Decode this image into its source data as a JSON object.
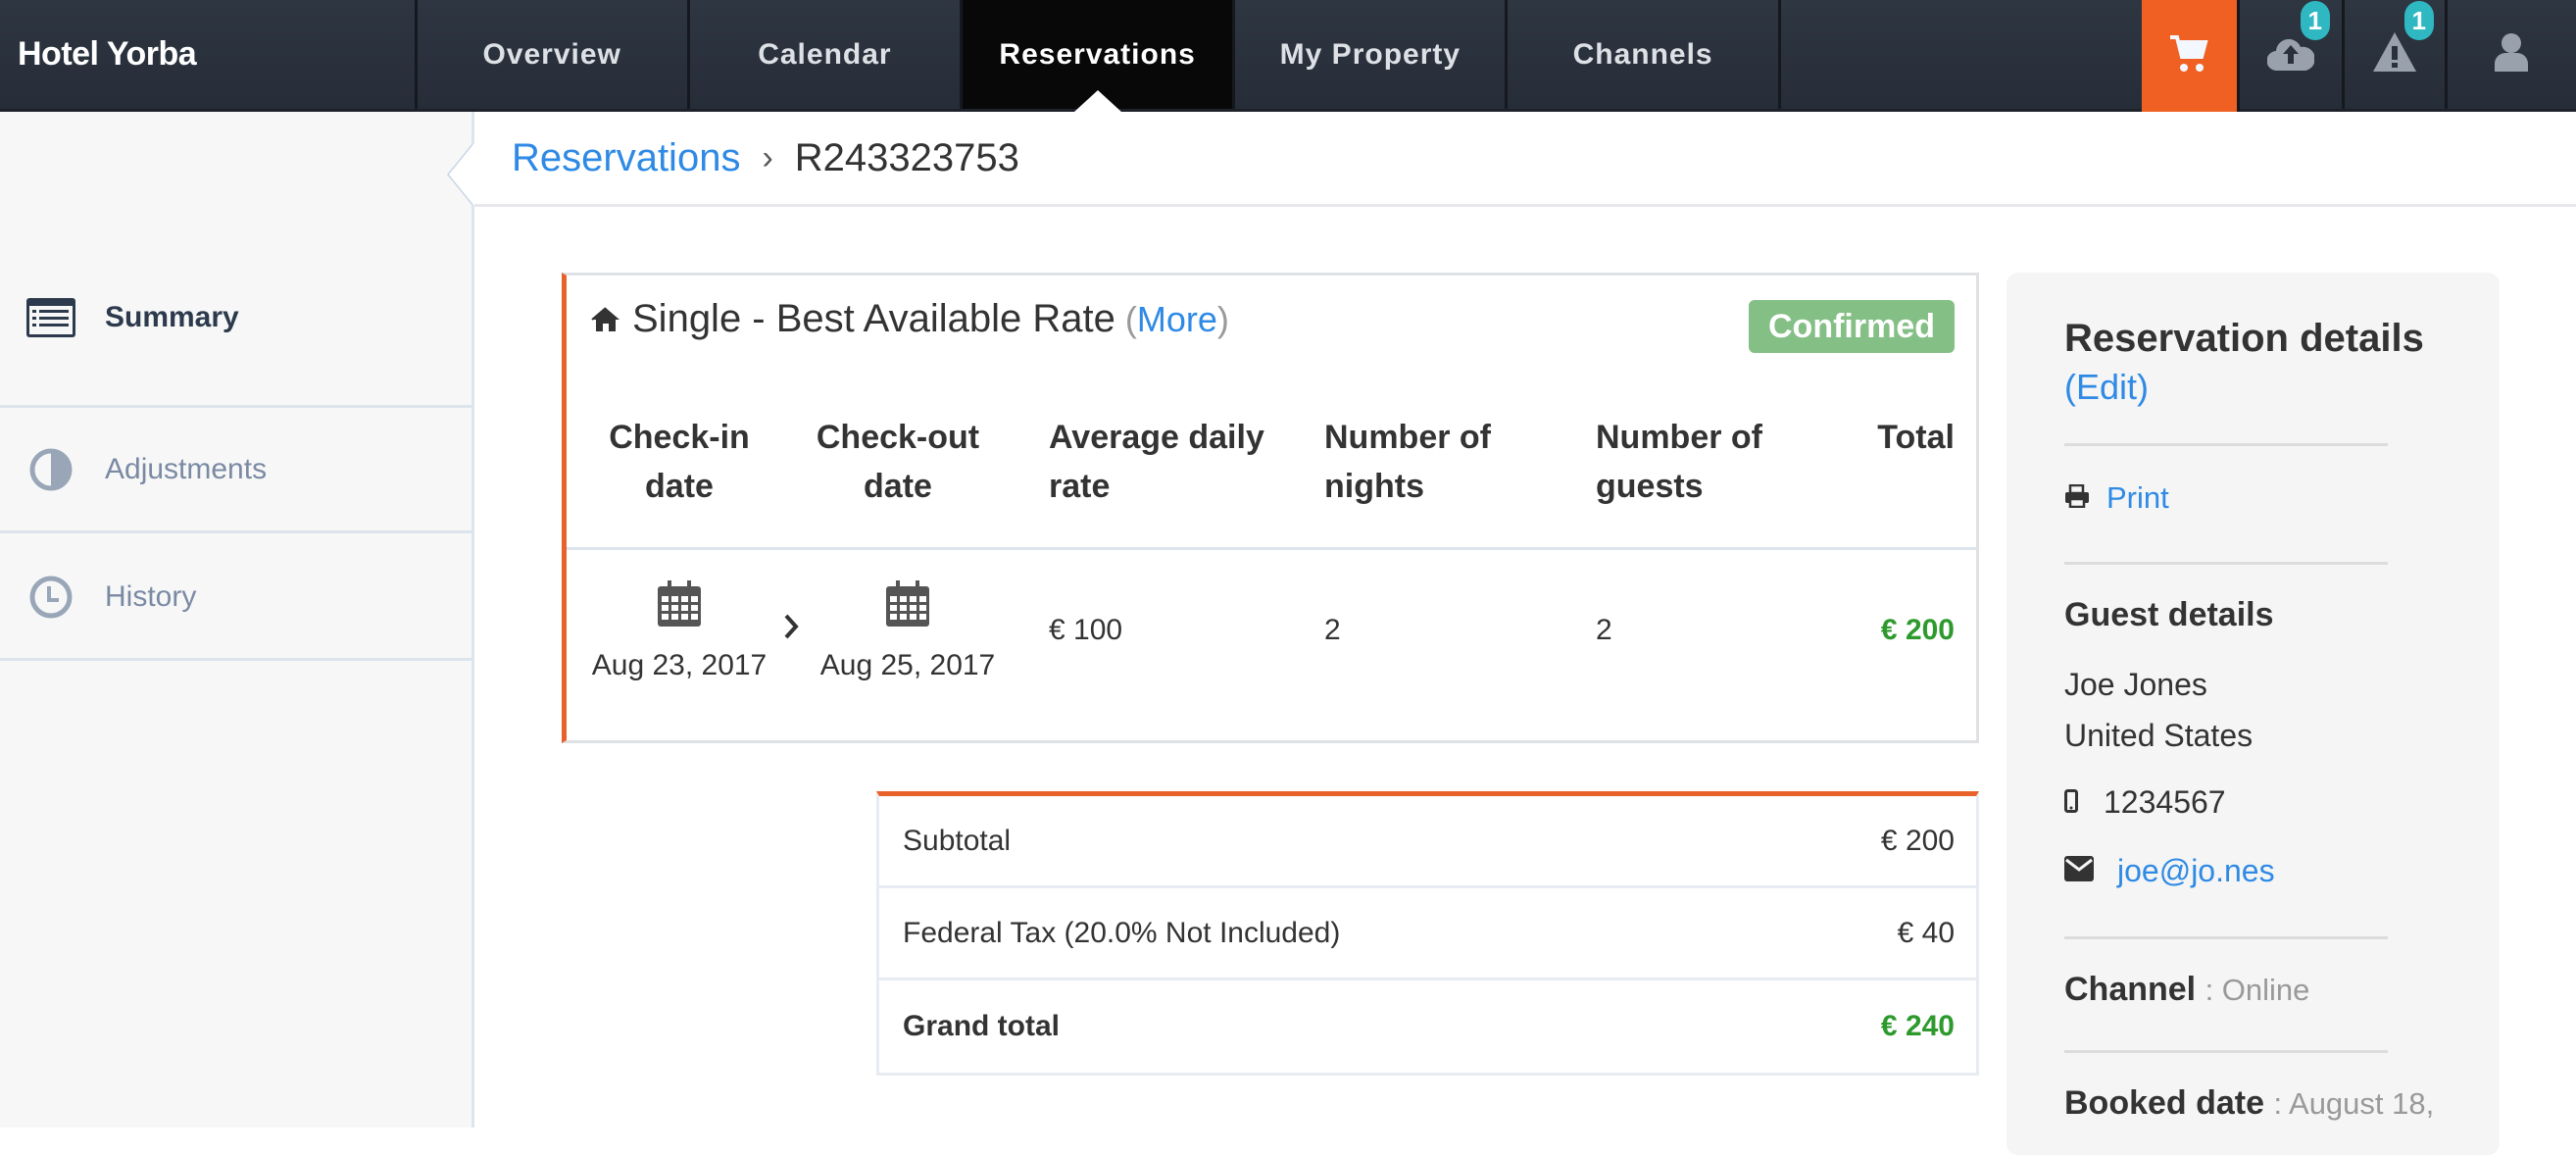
{
  "app": {
    "brand": "Hotel Yorba"
  },
  "nav": {
    "tabs": [
      {
        "label": "Overview",
        "active": false
      },
      {
        "label": "Calendar",
        "active": false
      },
      {
        "label": "Reservations",
        "active": true
      },
      {
        "label": "My Property",
        "active": false
      },
      {
        "label": "Channels",
        "active": false
      }
    ],
    "icons": [
      {
        "name": "cart-icon",
        "badge": null
      },
      {
        "name": "cloud-upload-icon",
        "badge": "1"
      },
      {
        "name": "warning-icon",
        "badge": "1"
      },
      {
        "name": "user-icon",
        "badge": null
      }
    ],
    "accent_color": "#f06022"
  },
  "sidebar": {
    "items": [
      {
        "label": "Summary",
        "icon": "list-icon",
        "active": true
      },
      {
        "label": "Adjustments",
        "icon": "contrast-icon",
        "active": false
      },
      {
        "label": "History",
        "icon": "clock-icon",
        "active": false
      }
    ]
  },
  "breadcrumb": {
    "parent": "Reservations",
    "separator": "›",
    "current": "R243323753"
  },
  "room": {
    "title": "Single - Best Available Rate",
    "more_open": "(",
    "more_label": "More",
    "more_close": ")",
    "status": "Confirmed",
    "status_color": "#84bf85",
    "columns": {
      "checkin": [
        "Check-in",
        "date"
      ],
      "checkout": [
        "Check-out",
        "date"
      ],
      "rate": [
        "Average daily",
        "rate"
      ],
      "nights": [
        "Number of",
        "nights"
      ],
      "guests": [
        "Number of",
        "guests"
      ],
      "total": [
        "Total",
        ""
      ]
    },
    "row": {
      "checkin": "Aug 23, 2017",
      "checkout": "Aug 25, 2017",
      "rate": "€ 100",
      "nights": "2",
      "guests": "2",
      "total": "€ 200"
    }
  },
  "totals": {
    "rows": [
      {
        "label": "Subtotal",
        "value": "€ 200"
      },
      {
        "label": "Federal Tax (20.0% Not Included)",
        "value": "€ 40"
      },
      {
        "label": "Grand total",
        "value": "€ 240"
      }
    ]
  },
  "details": {
    "title": "Reservation details",
    "edit_label": "(Edit)",
    "print_label": "Print",
    "guest_title": "Guest details",
    "guest_name": "Joe Jones",
    "guest_country": "United States",
    "phone": "1234567",
    "email": "joe@jo.nes",
    "channel_label": "Channel",
    "channel_value": ": Online",
    "booked_label": "Booked date",
    "booked_value": ": August 18,"
  }
}
